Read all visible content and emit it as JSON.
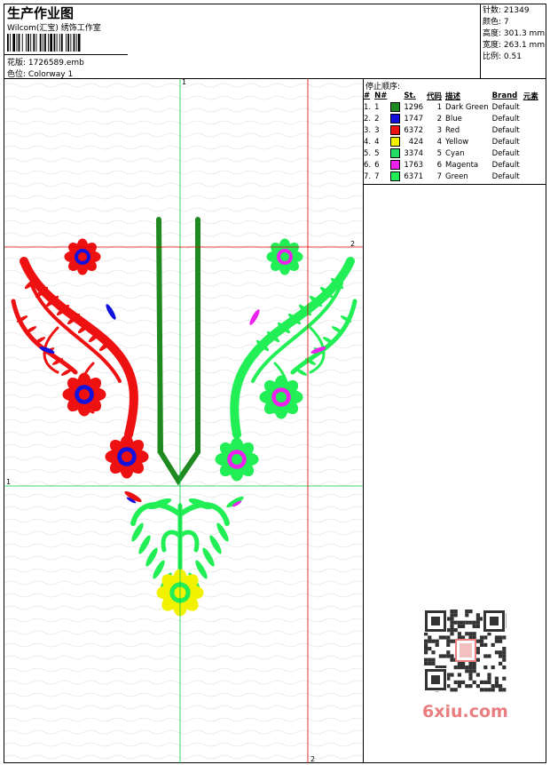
{
  "header": {
    "title": "生产作业图",
    "studio": "Wilcom(汇宝) 绣饰工作室",
    "design_label": "花版:",
    "design_value": "1726589.emb",
    "colorway_label": "色位:",
    "colorway_value": "Colorway 1"
  },
  "stats": [
    {
      "label": "针数:",
      "value": "21349"
    },
    {
      "label": "颜色:",
      "value": "7"
    },
    {
      "label": "高度:",
      "value": "301.3 mm"
    },
    {
      "label": "宽度:",
      "value": "263.1 mm"
    },
    {
      "label": "比例:",
      "value": "0.51"
    }
  ],
  "stop_sequence": {
    "heading": "停止顺序:",
    "columns": [
      "#",
      "N#",
      "St.",
      "代码",
      "描述",
      "Brand",
      "元素"
    ],
    "rows": [
      {
        "idx": "1.",
        "n": "1",
        "color": "#1f8a1f",
        "stitches": "1296",
        "code": "1",
        "desc": "Dark Green",
        "brand": "Default"
      },
      {
        "idx": "2.",
        "n": "2",
        "color": "#1111dd",
        "stitches": "1747",
        "code": "2",
        "desc": "Blue",
        "brand": "Default"
      },
      {
        "idx": "3.",
        "n": "3",
        "color": "#ee1111",
        "stitches": "6372",
        "code": "3",
        "desc": "Red",
        "brand": "Default"
      },
      {
        "idx": "4.",
        "n": "4",
        "color": "#f2f200",
        "stitches": "424",
        "code": "4",
        "desc": "Yellow",
        "brand": "Default"
      },
      {
        "idx": "5.",
        "n": "5",
        "color": "#22dd66",
        "stitches": "3374",
        "code": "5",
        "desc": "Cyan",
        "brand": "Default"
      },
      {
        "idx": "6.",
        "n": "6",
        "color": "#ee22ee",
        "stitches": "1763",
        "code": "6",
        "desc": "Magenta",
        "brand": "Default"
      },
      {
        "idx": "7.",
        "n": "7",
        "color": "#22ee55",
        "stitches": "6371",
        "code": "7",
        "desc": "Green",
        "brand": "Default"
      }
    ]
  },
  "axes": {
    "v1": "1",
    "h1": "1",
    "h2": "2",
    "v2": "2"
  },
  "watermark": "6xiu.com",
  "colors": {
    "red": "#ee1111",
    "blue": "#1111dd",
    "dark_green": "#1f8a1f",
    "green": "#22ee55",
    "magenta": "#ee22ee",
    "yellow": "#f2f200",
    "guide_green": "#00cc44",
    "guide_red": "#dd0000"
  }
}
